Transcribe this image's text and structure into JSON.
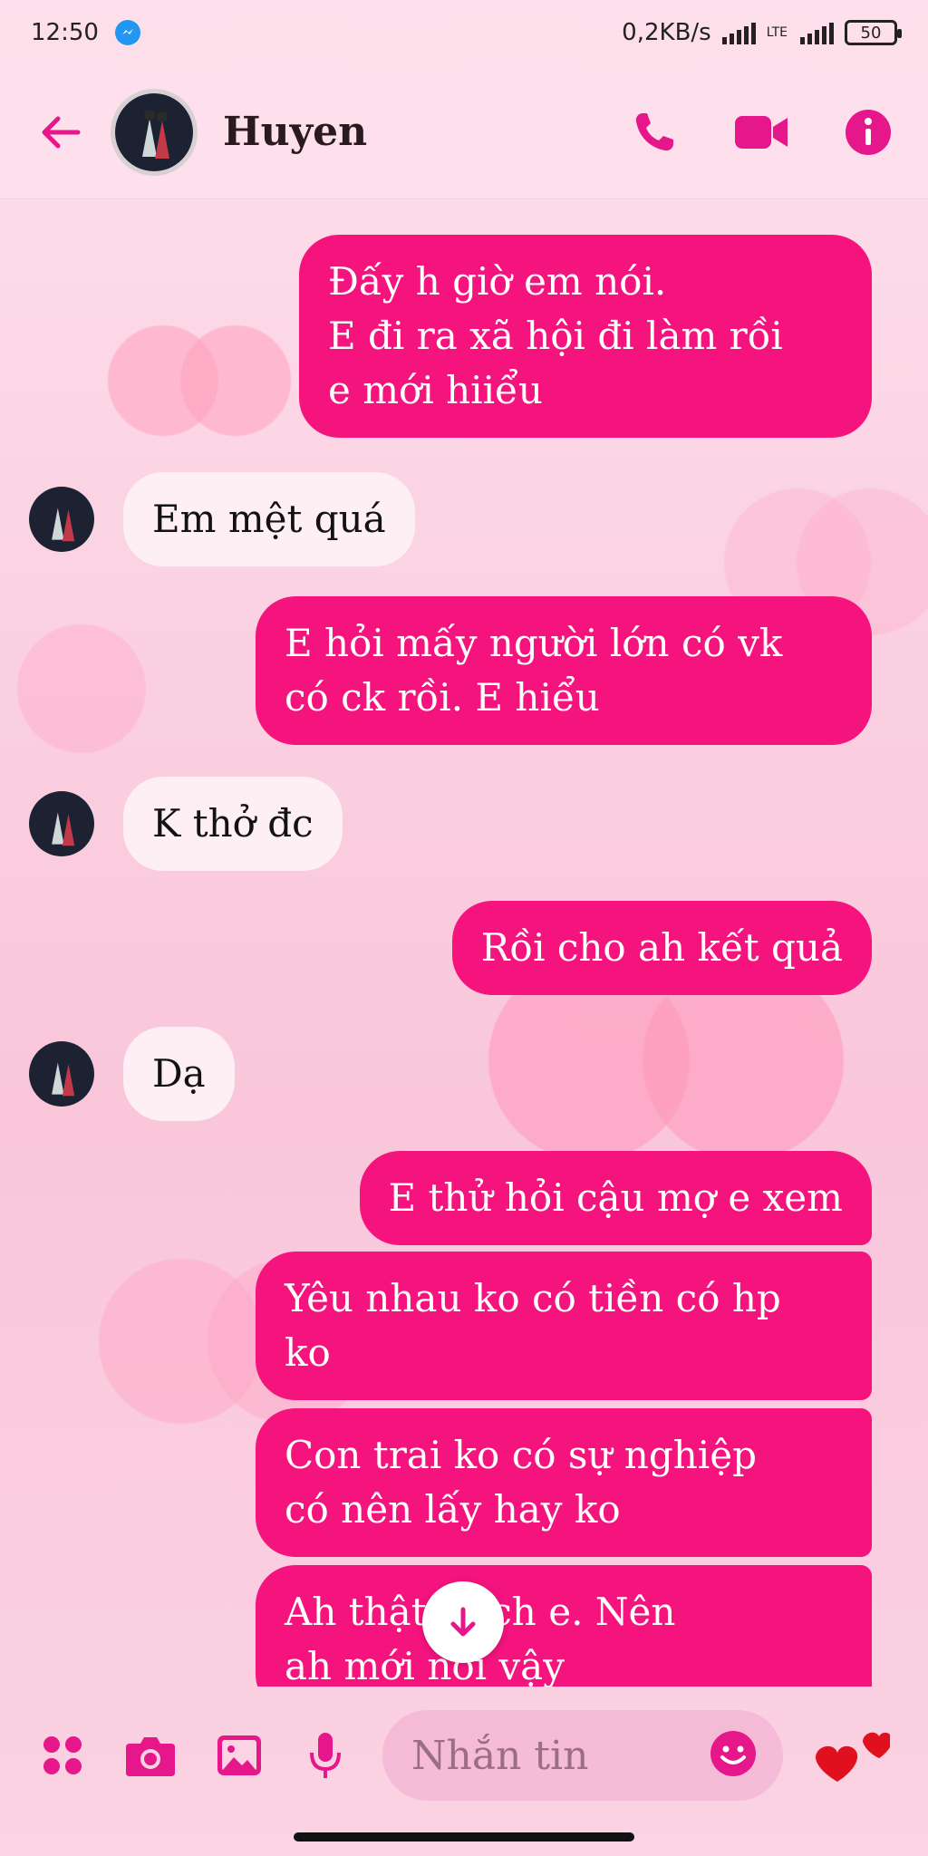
{
  "status_bar": {
    "time": "12:50",
    "network_speed": "0,2KB/s",
    "network_type": "LTE",
    "battery": "50"
  },
  "header": {
    "contact_name": "Huyen",
    "icons": [
      "back-arrow-icon",
      "phone-icon",
      "video-camera-icon",
      "info-icon"
    ],
    "accent": "#e6178a"
  },
  "messages": [
    {
      "side": "out",
      "lines": [
        "Đấy h giờ em nói.",
        "E đi ra xã hội đi làm rồi",
        "e  mới hiiểu"
      ]
    },
    {
      "side": "in",
      "lines": [
        "Em mệt quá"
      ]
    },
    {
      "side": "out",
      "lines": [
        "E hỏi mấy người lớn có vk",
        "có ck rồi. E hiểu"
      ]
    },
    {
      "side": "in",
      "lines": [
        "K thở đc"
      ]
    },
    {
      "side": "out",
      "lines": [
        "Rồi cho ah kết quả"
      ]
    },
    {
      "side": "in",
      "lines": [
        "Dạ"
      ]
    },
    {
      "side": "out",
      "lines": [
        "E thử hỏi cậu mợ e xem"
      ]
    },
    {
      "side": "out",
      "lines": [
        "Yêu nhau ko có tiền có hp",
        "ko"
      ]
    },
    {
      "side": "out",
      "lines": [
        "Con trai ko có sự nghiệp",
        "có nên lấy hay ko"
      ]
    },
    {
      "side": "out",
      "lines": [
        "Ah thật    thích  e. Nên",
        "ah mới nói vậy"
      ]
    }
  ],
  "composer": {
    "placeholder": "Nhắn tin",
    "icons": [
      "apps-icon",
      "camera-icon",
      "image-icon",
      "microphone-icon",
      "emoji-icon",
      "hearts-icon"
    ]
  },
  "colors": {
    "outgoing_bubble": "#f5137e",
    "incoming_bubble": "#fdeff3",
    "background": "#fbd3e3"
  }
}
